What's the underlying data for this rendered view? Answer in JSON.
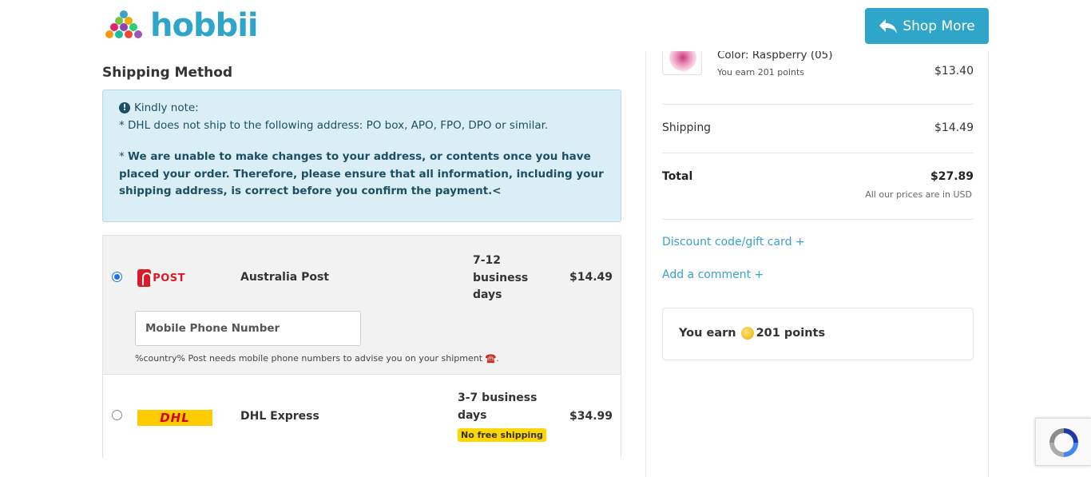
{
  "header": {
    "logo_text": "hobbii",
    "shop_more_label": "Shop More",
    "brand_color": "#2fa6c9"
  },
  "shipping": {
    "section_title": "Shipping Method",
    "note": {
      "title": "Kindly note:",
      "line1": "* DHL does not ship to the following address: PO box, APO, FPO, DPO or similar.",
      "line2_prefix": "* ",
      "line2_bold": "We are unable to make changes to your address, or contents once you have placed your order. Therefore, please ensure that all information, including your shipping address, is correct before you confirm the payment.<"
    },
    "options": [
      {
        "carrier": "Australia Post",
        "logo_text": "POST",
        "days": "7-12 business days",
        "price": "$14.49",
        "selected": true,
        "phone_placeholder": "Mobile Phone Number",
        "phone_note": "%country% Post needs mobile phone numbers to advise you on your shipment",
        "phone_note_icon": "☎️."
      },
      {
        "carrier": "DHL Express",
        "logo_text": "DHL",
        "days": "3-7 business days",
        "price": "$34.99",
        "selected": false,
        "badge": "No free shipping"
      }
    ]
  },
  "summary": {
    "product": {
      "color_label": "Color: Raspberry (05)",
      "earn_text": "You earn 201 points",
      "price": "$13.40"
    },
    "shipping_label": "Shipping",
    "shipping_value": "$14.49",
    "total_label": "Total",
    "total_value": "$27.89",
    "currency_note": "All our prices are in USD",
    "discount_link": "Discount code/gift card +",
    "comment_link": "Add a comment +",
    "earn_box": {
      "prefix": "You earn",
      "points": "201 points"
    }
  }
}
